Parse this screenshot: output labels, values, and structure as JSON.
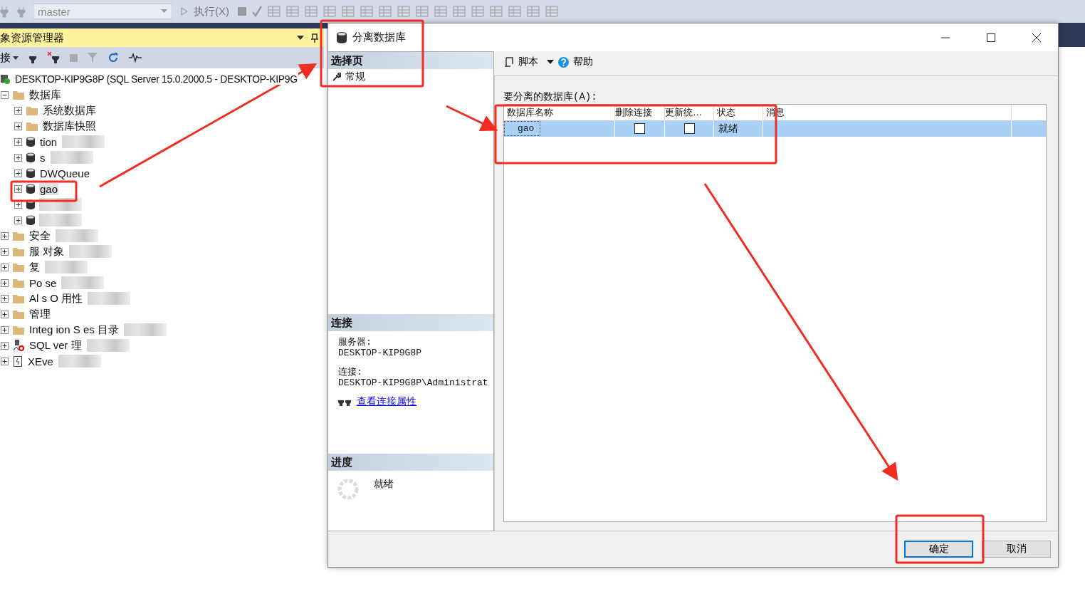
{
  "toolbar": {
    "database": "master",
    "execute": "执行(X)"
  },
  "object_explorer": {
    "title": "象资源管理器",
    "connect": "接",
    "server": "DESKTOP-KIP9G8P (SQL Server 15.0.2000.5 - DESKTOP-KIP9G",
    "tree": [
      {
        "label": "数据库",
        "kind": "folder",
        "expanded": true,
        "children": [
          {
            "label": "系统数据库",
            "kind": "folder"
          },
          {
            "label": "数据库快照",
            "kind": "folder"
          },
          {
            "label": "tion",
            "kind": "database",
            "redacted": true
          },
          {
            "label": "s",
            "kind": "database",
            "redacted": true
          },
          {
            "label": "DWQueue",
            "kind": "database"
          },
          {
            "label": "gao",
            "kind": "database",
            "highlighted": true
          },
          {
            "kind": "database",
            "redacted": true
          },
          {
            "kind": "database",
            "redacted": true
          }
        ]
      },
      {
        "label": "安全",
        "kind": "folder",
        "expanded": false,
        "redacted": true
      },
      {
        "label": "服 对象",
        "kind": "folder",
        "expanded": false,
        "redacted": true
      },
      {
        "label": "复",
        "kind": "folder",
        "expanded": false,
        "redacted": true
      },
      {
        "label": "Po se",
        "kind": "folder",
        "expanded": false,
        "redacted": true
      },
      {
        "label": "Al s O 用性",
        "kind": "folder",
        "expanded": false,
        "redacted": true
      },
      {
        "label": "管理",
        "kind": "folder",
        "expanded": false
      },
      {
        "label": "Integ ion S es 目录",
        "kind": "folder",
        "expanded": false,
        "redacted": true
      },
      {
        "label": "SQL ver 理",
        "kind": "agent",
        "expanded": false,
        "redacted": true
      },
      {
        "label": "XEve",
        "kind": "xevent",
        "expanded": false,
        "redacted": true
      }
    ]
  },
  "dialog": {
    "title": "分离数据库",
    "select_page": {
      "header": "选择页",
      "items": [
        "常规"
      ]
    },
    "toolbar": {
      "script": "脚本",
      "help": "帮助"
    },
    "connection": {
      "header": "连接",
      "server_label": "服务器:",
      "server": "DESKTOP-KIP9G8P",
      "connection_label": "连接:",
      "connection": "DESKTOP-KIP9G8P\\Administrat",
      "link": "查看连接属性"
    },
    "progress": {
      "header": "进度",
      "status": "就绪"
    },
    "grid_label": "要分离的数据库(A):",
    "columns": [
      "数据库名称",
      "删除连接",
      "更新统…",
      "状态",
      "消息"
    ],
    "rows": [
      {
        "name": "gao",
        "drop_connections": false,
        "update_statistics": false,
        "status": "就绪",
        "selected": true
      }
    ],
    "buttons": [
      {
        "label": "确定",
        "default": true
      },
      {
        "label": "取消",
        "default": false
      }
    ]
  }
}
